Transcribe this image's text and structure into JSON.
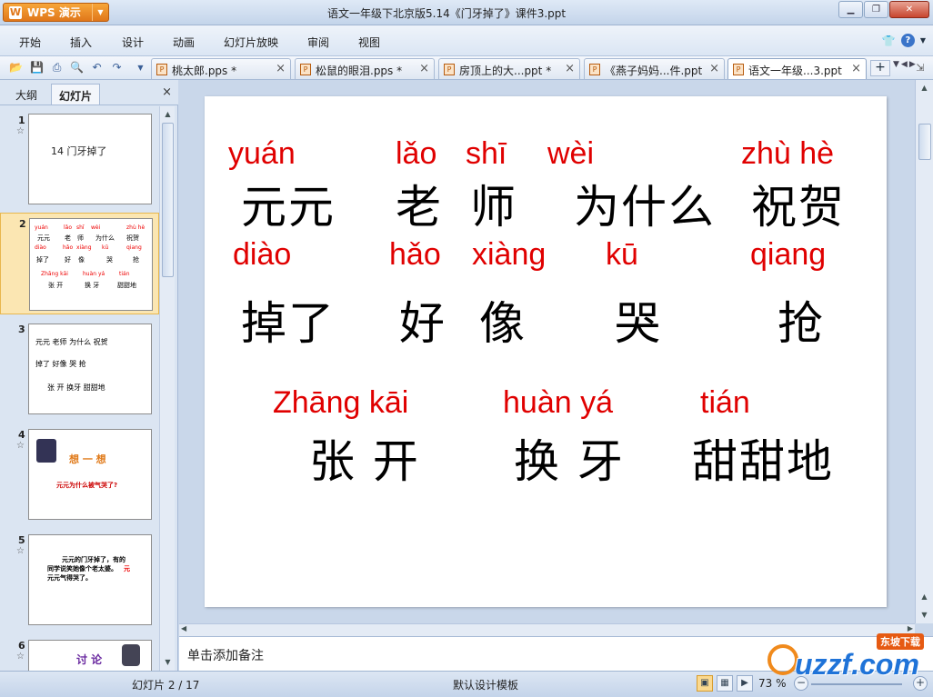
{
  "app": {
    "name": "WPS 演示",
    "window_title": "语文一年级下北京版5.14《门牙掉了》课件3.ppt"
  },
  "menu": [
    "开始",
    "插入",
    "设计",
    "动画",
    "幻灯片放映",
    "审阅",
    "视图"
  ],
  "tabs": [
    {
      "label": "桃太郎.pps *"
    },
    {
      "label": "松鼠的眼泪.pps *"
    },
    {
      "label": "房顶上的大...ppt *"
    },
    {
      "label": "《燕子妈妈...件.ppt"
    },
    {
      "label": "语文一年级...3.ppt"
    }
  ],
  "panel": {
    "tab_outline": "大纲",
    "tab_slides": "幻灯片",
    "close": "×"
  },
  "thumbnails": {
    "s1": {
      "num": "1",
      "text": "14  门牙掉了"
    },
    "s2": {
      "num": "2"
    },
    "s3": {
      "num": "3",
      "lines": [
        "元元  老师  为什么  祝贺",
        "掉了  好像    哭      抢",
        "张 开    换牙   甜甜地"
      ]
    },
    "s4": {
      "num": "4",
      "title": "想 一 想",
      "text": "元元为什么被气哭了?"
    },
    "s5": {
      "num": "5",
      "text1": "元元的门牙掉了，有的",
      "text2": "同学说笑她像个老太婆。",
      "text3": "元元气得哭了。",
      "red": "元"
    },
    "s6": {
      "num": "6",
      "text": "讨 论"
    }
  },
  "slide": {
    "row1_pinyin": [
      "yuán",
      "lǎo",
      "shī",
      "wèi",
      "zhù hè"
    ],
    "row1_hanzi": [
      "元元",
      "老",
      "师",
      "为什么",
      "祝贺"
    ],
    "row2_pinyin": [
      "diào",
      "hǎo",
      "xiàng",
      "kū",
      "qiang"
    ],
    "row2_hanzi": [
      "掉了",
      "好",
      "像",
      "哭",
      "抢"
    ],
    "row3_pinyin": [
      "Zhāng kāi",
      "huàn yá",
      "tián"
    ],
    "row3_hanzi": [
      "张  开",
      "换  牙",
      "甜甜地"
    ]
  },
  "notes_placeholder": "单击添加备注",
  "status": {
    "slide_indicator": "幻灯片 2 / 17",
    "template": "默认设计模板",
    "zoom": "73 %"
  },
  "watermark": {
    "text": "uzzf.com",
    "badge": "东坡下载"
  },
  "colors": {
    "pinyin": "#e00000",
    "accent": "#e0771a",
    "panel_bg": "#dbe5f2"
  }
}
